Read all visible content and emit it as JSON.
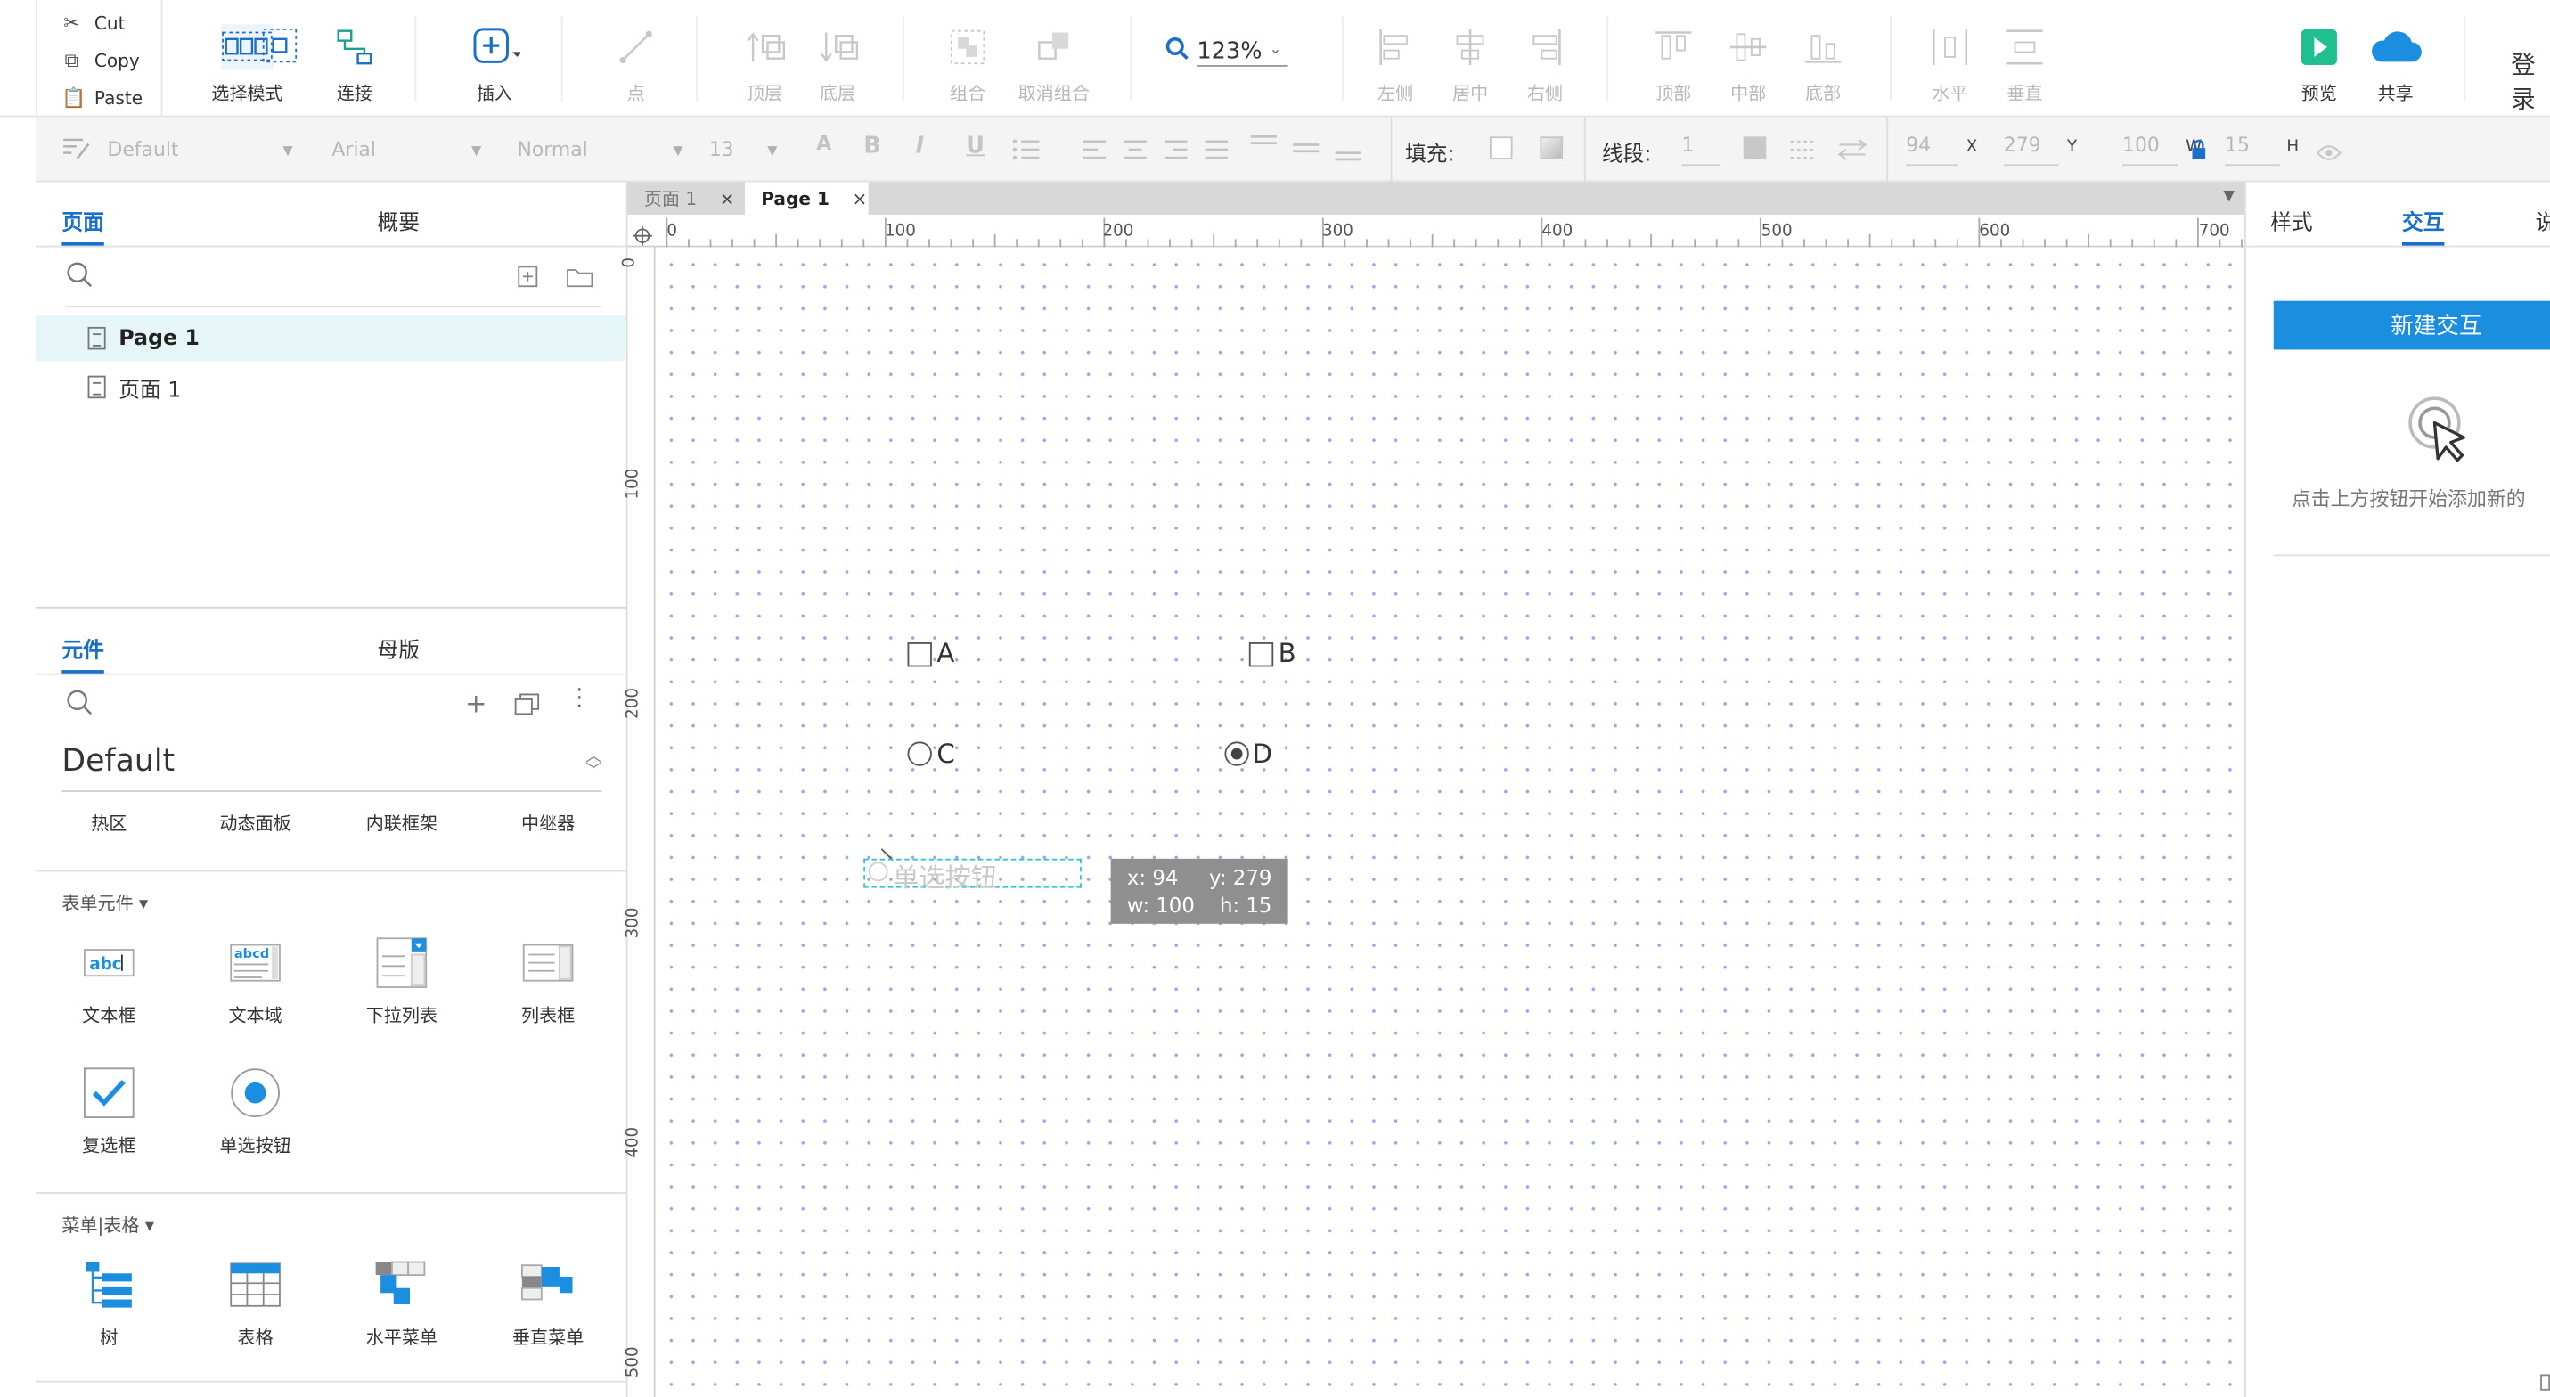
{
  "clipboard": {
    "cut": "Cut",
    "copy": "Copy",
    "paste": "Paste"
  },
  "toolbar": {
    "select_mode": "选择模式",
    "connect": "连接",
    "insert": "插入",
    "point": "点",
    "bring_front": "顶层",
    "send_back": "底层",
    "group": "组合",
    "ungroup": "取消组合",
    "zoom": "123%",
    "align_left": "左侧",
    "align_center": "居中",
    "align_right": "右侧",
    "align_top": "顶部",
    "align_middle": "中部",
    "align_bottom": "底部",
    "dist_horizontal": "水平",
    "dist_vertical": "垂直",
    "preview": "预览",
    "share": "共享",
    "login": "登录"
  },
  "format": {
    "style": "Default",
    "font": "Arial",
    "weight": "Normal",
    "size": "13",
    "fill_label": "填充:",
    "stroke_label": "线段:",
    "stroke_value": "1",
    "x_value": "94",
    "x_label": "X",
    "y_value": "279",
    "y_label": "Y",
    "w_value": "100",
    "w_label": "W",
    "h_value": "15",
    "h_label": "H"
  },
  "pages_panel": {
    "tab_pages": "页面",
    "tab_outline": "概要",
    "items": [
      {
        "label": "Page 1",
        "selected": true
      },
      {
        "label": "页面 1",
        "selected": false
      }
    ]
  },
  "widgets_panel": {
    "tab_widgets": "元件",
    "tab_masters": "母版",
    "library": "Default",
    "row0": [
      "热区",
      "动态面板",
      "内联框架",
      "中继器"
    ],
    "section_form": "表单元件 ▾",
    "form": [
      "文本框",
      "文本域",
      "下拉列表",
      "列表框",
      "复选框",
      "单选按钮"
    ],
    "section_menu": "菜单|表格 ▾",
    "menu": [
      "树",
      "表格",
      "水平菜单",
      "垂直菜单"
    ]
  },
  "doc_tabs": [
    {
      "label": "页面 1",
      "active": false
    },
    {
      "label": "Page 1",
      "active": true
    }
  ],
  "ruler": {
    "h": [
      "0",
      "100",
      "200",
      "300",
      "400",
      "500",
      "600",
      "700"
    ],
    "v": [
      "0",
      "100",
      "200",
      "300",
      "400",
      "500"
    ]
  },
  "canvas": {
    "a": "A",
    "b": "B",
    "c": "C",
    "d": "D",
    "drag_label": "单选按钮",
    "readout_x": "x: 94",
    "readout_y": "y: 279",
    "readout_w": "w: 100",
    "readout_h": "h: 15"
  },
  "right_panel": {
    "tab_style": "样式",
    "tab_interact": "交互",
    "tab_notes": "说",
    "new_interaction": "新建交互",
    "hint": "点击上方按钮开始添加新的"
  },
  "colors": {
    "accent": "#1b6fc8",
    "button": "#1b8ee0",
    "selection": "#35c6d4",
    "grid_dot": "#9aa6e8"
  }
}
